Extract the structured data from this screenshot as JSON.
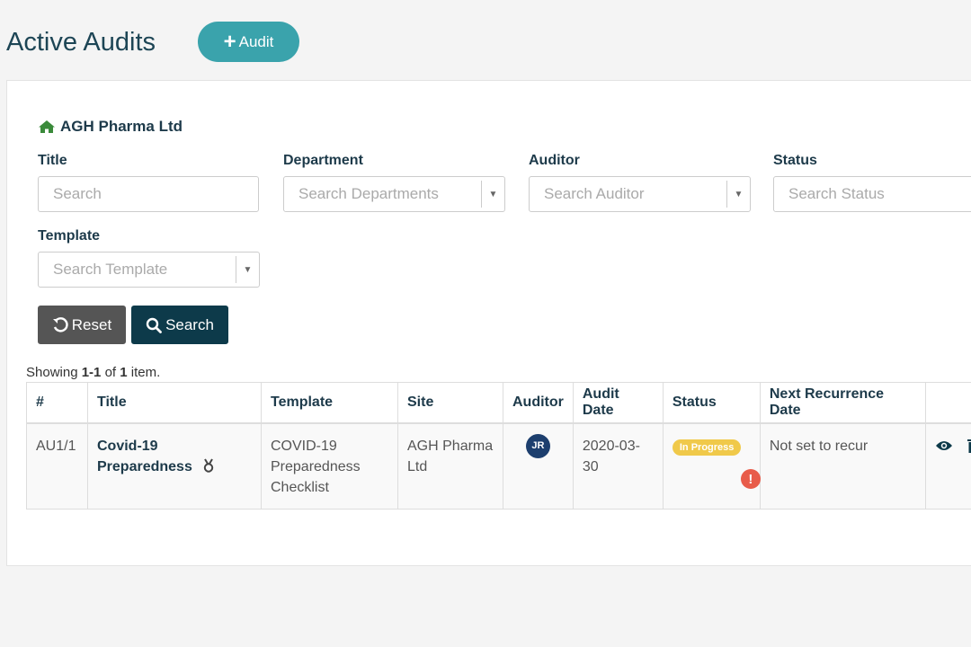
{
  "header": {
    "title": "Active Audits",
    "add_button_label": "Audit"
  },
  "organization": "AGH Pharma Ltd",
  "filters": {
    "title": {
      "label": "Title",
      "placeholder": "Search"
    },
    "department": {
      "label": "Department",
      "placeholder": "Search Departments"
    },
    "auditor": {
      "label": "Auditor",
      "placeholder": "Search Auditor"
    },
    "status": {
      "label": "Status",
      "placeholder": "Search Status"
    },
    "template": {
      "label": "Template",
      "placeholder": "Search Template"
    }
  },
  "buttons": {
    "reset": "Reset",
    "search": "Search"
  },
  "summary": {
    "prefix": "Showing ",
    "range": "1-1",
    "of": " of ",
    "total": "1",
    "suffix": " item."
  },
  "table": {
    "columns": [
      "#",
      "Title",
      "Template",
      "Site",
      "Auditor",
      "Audit Date",
      "Status",
      "Next Recurrence Date",
      ""
    ],
    "rows": [
      {
        "id": "AU1/1",
        "title": "Covid-19 Preparedness",
        "template": "COVID-19 Preparedness Checklist",
        "site": "AGH Pharma Ltd",
        "auditor_initials": "JR",
        "audit_date": "2020-03-30",
        "status": "In Progress",
        "alert": "!",
        "next_recurrence": "Not set to recur"
      }
    ]
  },
  "colors": {
    "accent": "#3aa3ac",
    "primary_dark": "#0d3a4a",
    "status_in_progress": "#f0c94a",
    "alert": "#e85c4a",
    "avatar": "#1d3f6e",
    "home_icon": "#3a8a3a"
  }
}
